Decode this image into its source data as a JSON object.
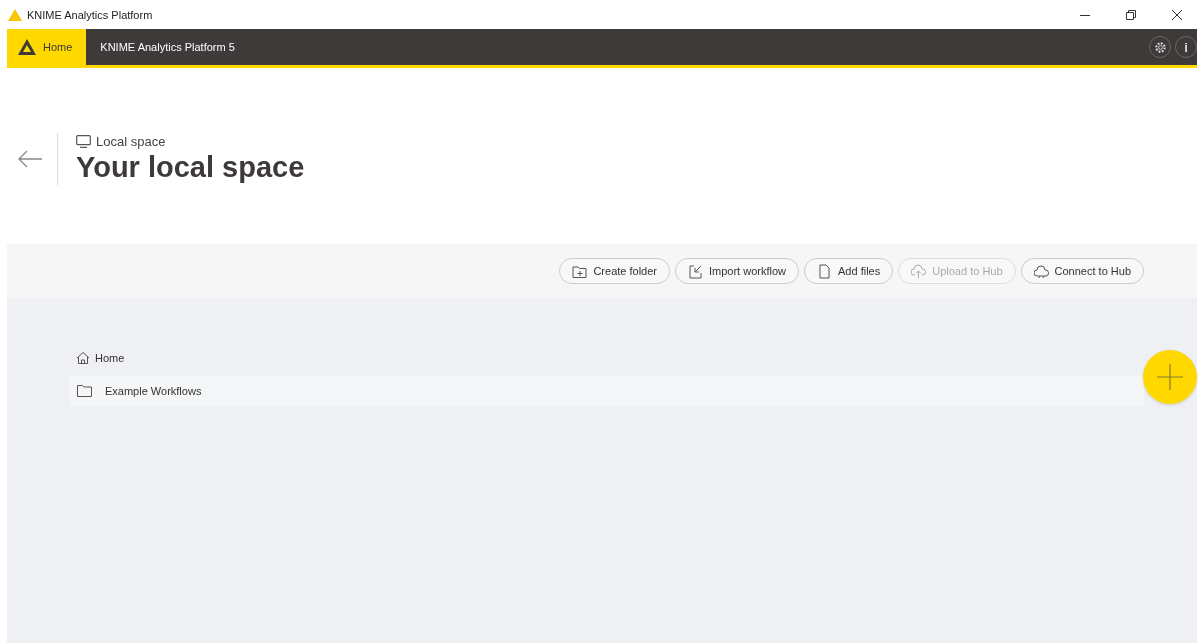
{
  "window": {
    "title": "KNIME Analytics Platform"
  },
  "tabs": [
    {
      "label": "Home",
      "kind": "home",
      "selected": true
    },
    {
      "label": "KNIME Analytics Platform 5",
      "kind": "plain",
      "selected": false
    }
  ],
  "top_actions": [
    {
      "kind": "settings"
    },
    {
      "kind": "info",
      "label": "i"
    }
  ],
  "header": {
    "space_label": "Local space",
    "title": "Your local space"
  },
  "toolbar": [
    {
      "label": "Create folder",
      "kind": "create",
      "disabled": false
    },
    {
      "label": "Import workflow",
      "kind": "import",
      "disabled": false
    },
    {
      "label": "Add files",
      "kind": "add",
      "disabled": false
    },
    {
      "label": "Upload to Hub",
      "kind": "upload",
      "disabled": true
    },
    {
      "label": "Connect to Hub",
      "kind": "connect",
      "disabled": false
    }
  ],
  "breadcrumb": [
    {
      "label": "Home"
    }
  ],
  "items": [
    {
      "label": "Example Workflows",
      "kind": "folder"
    }
  ]
}
